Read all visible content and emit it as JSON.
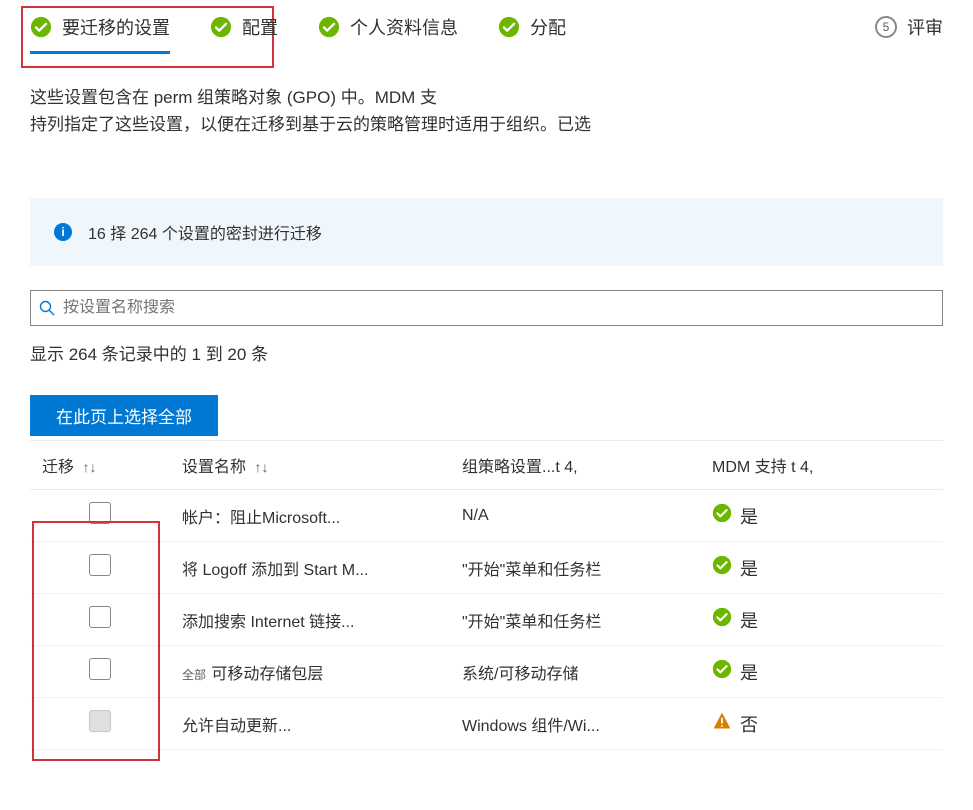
{
  "stepper": {
    "steps": [
      {
        "label": "要迁移的设置",
        "icon": "check",
        "active": true
      },
      {
        "label": "配置",
        "icon": "check"
      },
      {
        "label": "个人资料信息",
        "icon": "check"
      },
      {
        "label": "分配",
        "icon": "check"
      },
      {
        "label": "评审",
        "icon": "number",
        "number": "5"
      }
    ]
  },
  "description": {
    "line1": "这些设置包含在 perm 组策略对象 (GPO) 中。MDM 支",
    "line2": "持列指定了这些设置，以便在迁移到基于云的策略管理时适用于组织。已选"
  },
  "info_bar": {
    "text": "16 择 264 个设置的密封进行迁移"
  },
  "search": {
    "placeholder": "按设置名称搜索"
  },
  "record_count": "显示 264 条记录中的 1 到 20 条",
  "select_all_label": "在此页上选择全部",
  "columns": {
    "migrate": "迁移",
    "name": "设置名称",
    "gpo": "组策略设置...t 4,",
    "mdm": "MDM 支持 t 4,"
  },
  "sort_glyph": "↑↓",
  "rows": [
    {
      "name": "帐户：阻止Microsoft...",
      "gpo": "N/A",
      "mdm_ok": true,
      "mdm_text": "是",
      "name_prefix": ""
    },
    {
      "name": "将 Logoff 添加到 Start M...",
      "gpo": "\"开始\"菜单和任务栏",
      "mdm_ok": true,
      "mdm_text": "是",
      "name_prefix": ""
    },
    {
      "name": "添加搜索 Internet 链接...",
      "gpo": "\"开始\"菜单和任务栏",
      "mdm_ok": true,
      "mdm_text": "是",
      "name_prefix": ""
    },
    {
      "name": "可移动存储包层",
      "gpo": "系统/可移动存储",
      "mdm_ok": true,
      "mdm_text": "是",
      "name_prefix": "全部"
    },
    {
      "name": "允许自动更新...",
      "gpo": "Windows 组件/Wi...",
      "mdm_ok": false,
      "mdm_text": "否",
      "name_prefix": "",
      "disabled": true
    }
  ],
  "icons": {
    "check_color": "#6bb700",
    "warn_color": "#d67f00",
    "info_color": "#0078d4"
  }
}
